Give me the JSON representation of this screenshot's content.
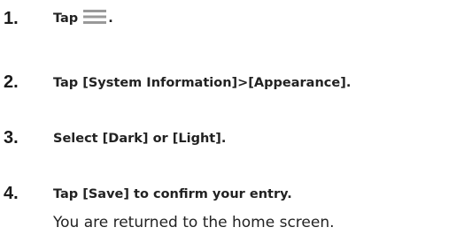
{
  "steps": [
    {
      "number": "1.",
      "text_before": "Tap",
      "icon": "hamburger-menu-icon",
      "text_after": "."
    },
    {
      "number": "2.",
      "text": "Tap [System Information]>[Appearance]."
    },
    {
      "number": "3.",
      "text": "Select [Dark] or [Light]."
    },
    {
      "number": "4.",
      "text": "Tap [Save] to confirm your entry.",
      "note": "You are returned to the home screen."
    }
  ],
  "colors": {
    "text": "#222222",
    "icon": "#999999"
  }
}
